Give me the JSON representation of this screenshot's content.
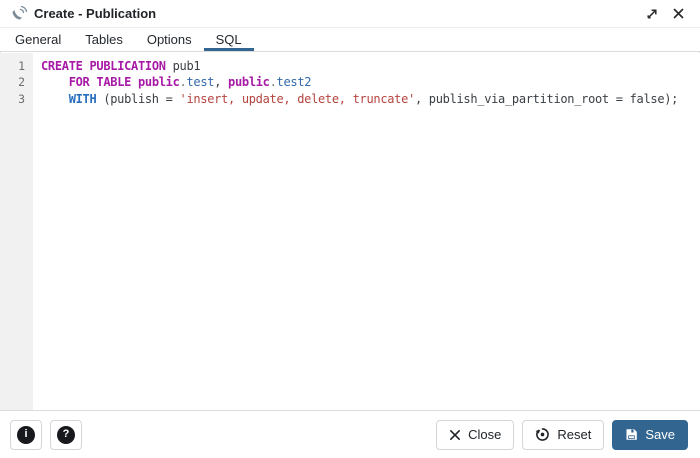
{
  "window": {
    "title": "Create - Publication"
  },
  "tabs": [
    {
      "label": "General",
      "active": false
    },
    {
      "label": "Tables",
      "active": false
    },
    {
      "label": "Options",
      "active": false
    },
    {
      "label": "SQL",
      "active": true
    }
  ],
  "editor": {
    "lines": [
      {
        "number": "1",
        "tokens": [
          {
            "t": "kw",
            "v": "CREATE"
          },
          {
            "t": "plain",
            "v": " "
          },
          {
            "t": "kw",
            "v": "PUBLICATION"
          },
          {
            "t": "plain",
            "v": " pub1"
          }
        ]
      },
      {
        "number": "2",
        "tokens": [
          {
            "t": "plain",
            "v": "    "
          },
          {
            "t": "kw",
            "v": "FOR"
          },
          {
            "t": "plain",
            "v": " "
          },
          {
            "t": "kw",
            "v": "TABLE"
          },
          {
            "t": "plain",
            "v": " "
          },
          {
            "t": "kw",
            "v": "public"
          },
          {
            "t": "punct",
            "v": "."
          },
          {
            "t": "ident",
            "v": "test"
          },
          {
            "t": "plain",
            "v": ", "
          },
          {
            "t": "kw",
            "v": "public"
          },
          {
            "t": "punct",
            "v": "."
          },
          {
            "t": "ident",
            "v": "test2"
          }
        ]
      },
      {
        "number": "3",
        "tokens": [
          {
            "t": "plain",
            "v": "    "
          },
          {
            "t": "builtin",
            "v": "WITH"
          },
          {
            "t": "plain",
            "v": " (publish = "
          },
          {
            "t": "str",
            "v": "'insert, update, delete, truncate'"
          },
          {
            "t": "plain",
            "v": ", publish_via_partition_root = false);"
          }
        ]
      }
    ]
  },
  "footer": {
    "info_glyph": "i",
    "help_glyph": "?",
    "close_label": "Close",
    "reset_label": "Reset",
    "save_label": "Save"
  },
  "colors": {
    "accent": "#326690",
    "tab_underline": "#326690",
    "keyword": "#a61aa6",
    "builtin": "#286ebe",
    "identifier": "#3269aa",
    "string": "#b5443f",
    "text": "#3a3f44",
    "gutter_bg": "#f1f1f1"
  }
}
